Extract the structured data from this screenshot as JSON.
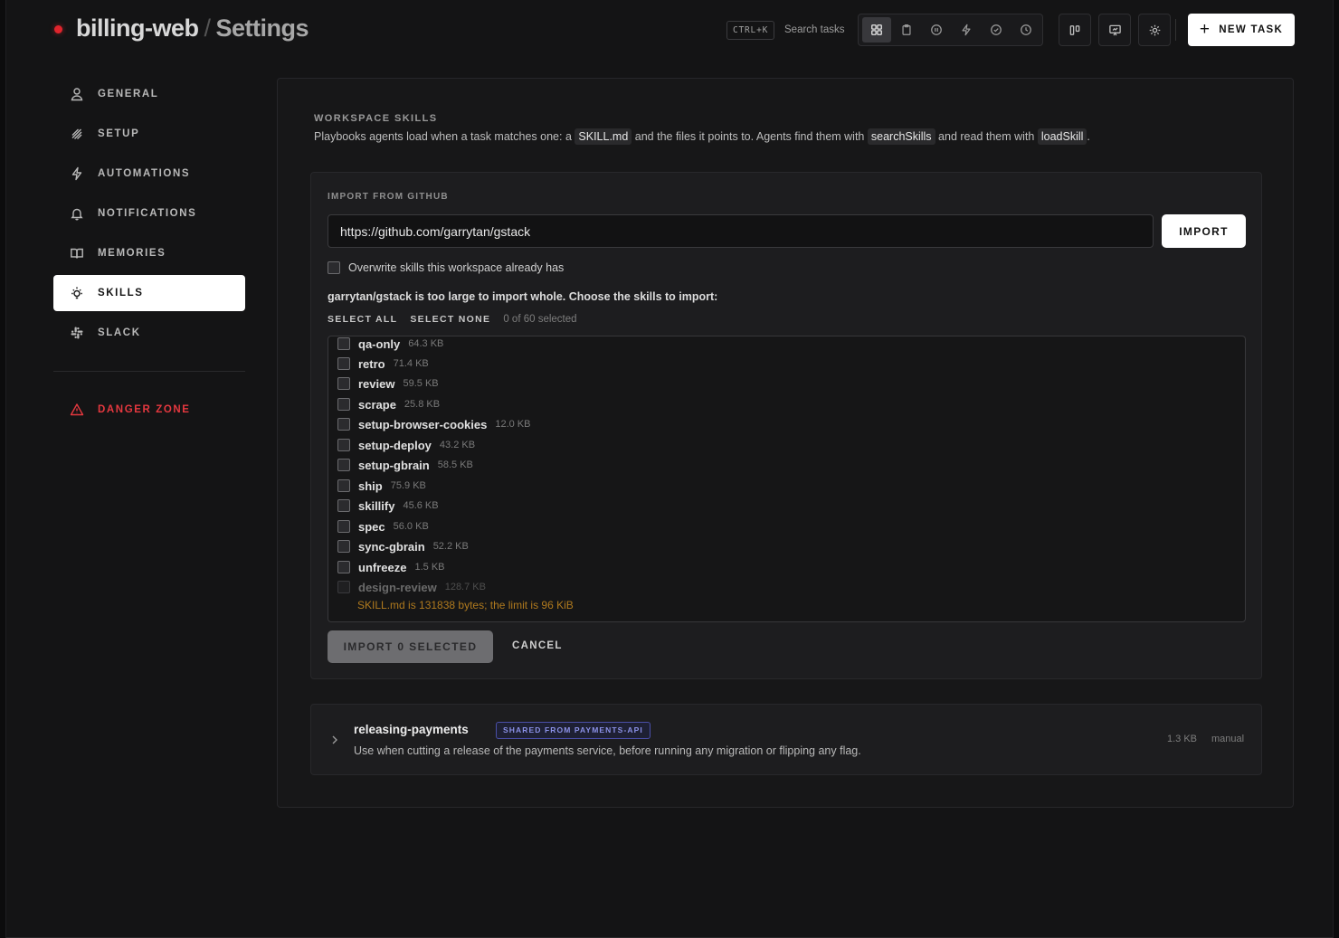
{
  "header": {
    "project": "billing-web",
    "separator": "/",
    "page": "Settings",
    "shortcut": "CTRL+K",
    "search_label": "Search tasks",
    "view_icons": [
      "grid-icon",
      "clipboard-icon",
      "pause-circle-icon",
      "bolt-icon",
      "check-circle-icon",
      "clock-icon"
    ],
    "new_task_label": "NEW TASK"
  },
  "sidebar": {
    "items": [
      {
        "label": "GENERAL",
        "icon": "user-icon"
      },
      {
        "label": "SETUP",
        "icon": "layers-icon"
      },
      {
        "label": "AUTOMATIONS",
        "icon": "bolt-icon"
      },
      {
        "label": "NOTIFICATIONS",
        "icon": "bell-icon"
      },
      {
        "label": "MEMORIES",
        "icon": "book-icon"
      },
      {
        "label": "SKILLS",
        "icon": "lightbulb-icon",
        "active": true
      },
      {
        "label": "SLACK",
        "icon": "slack-icon"
      }
    ],
    "danger": {
      "label": "DANGER ZONE",
      "icon": "warning-icon",
      "color": "#e5383f"
    }
  },
  "main": {
    "title": "WORKSPACE SKILLS",
    "desc_1": "Playbooks agents load when a task matches one: a",
    "desc_code_1": "SKILL.md",
    "desc_2": "and the files it points to. Agents find them with",
    "desc_code_2": "searchSkills",
    "desc_3": "and read them with",
    "desc_code_3": "loadSkill",
    "desc_4": ".",
    "import": {
      "title": "IMPORT FROM GITHUB",
      "url_value": "https://github.com/garrytan/gstack",
      "import_label": "IMPORT",
      "overwrite_label": "Overwrite skills this workspace already has",
      "too_large": "garrytan/gstack is too large to import whole. Choose the skills to import:",
      "select_all": "SELECT ALL",
      "select_none": "SELECT NONE",
      "selected_count": "0 of 60 selected",
      "skills": [
        {
          "name": "qa-only",
          "size": "64.3 KB"
        },
        {
          "name": "retro",
          "size": "71.4 KB"
        },
        {
          "name": "review",
          "size": "59.5 KB"
        },
        {
          "name": "scrape",
          "size": "25.8 KB"
        },
        {
          "name": "setup-browser-cookies",
          "size": "12.0 KB"
        },
        {
          "name": "setup-deploy",
          "size": "43.2 KB"
        },
        {
          "name": "setup-gbrain",
          "size": "58.5 KB"
        },
        {
          "name": "ship",
          "size": "75.9 KB"
        },
        {
          "name": "skillify",
          "size": "45.6 KB"
        },
        {
          "name": "spec",
          "size": "56.0 KB"
        },
        {
          "name": "sync-gbrain",
          "size": "52.2 KB"
        },
        {
          "name": "unfreeze",
          "size": "1.5 KB"
        },
        {
          "name": "design-review",
          "size": "128.7 KB",
          "disabled": true
        }
      ],
      "warning": "SKILL.md is 131838 bytes; the limit is 96 KiB",
      "warning_color": "#b07a1e",
      "import_selected_label": "IMPORT 0 SELECTED",
      "cancel_label": "CANCEL"
    },
    "skill_card": {
      "name": "releasing-payments",
      "badge": "SHARED FROM PAYMENTS-API",
      "description": "Use when cutting a release of the payments service, before running any migration or flipping any flag.",
      "size": "1.3 KB",
      "mode": "manual"
    }
  },
  "colors": {
    "accent_red": "#e0242c",
    "badge_blue": "#8c92e8",
    "background": "#141415"
  }
}
